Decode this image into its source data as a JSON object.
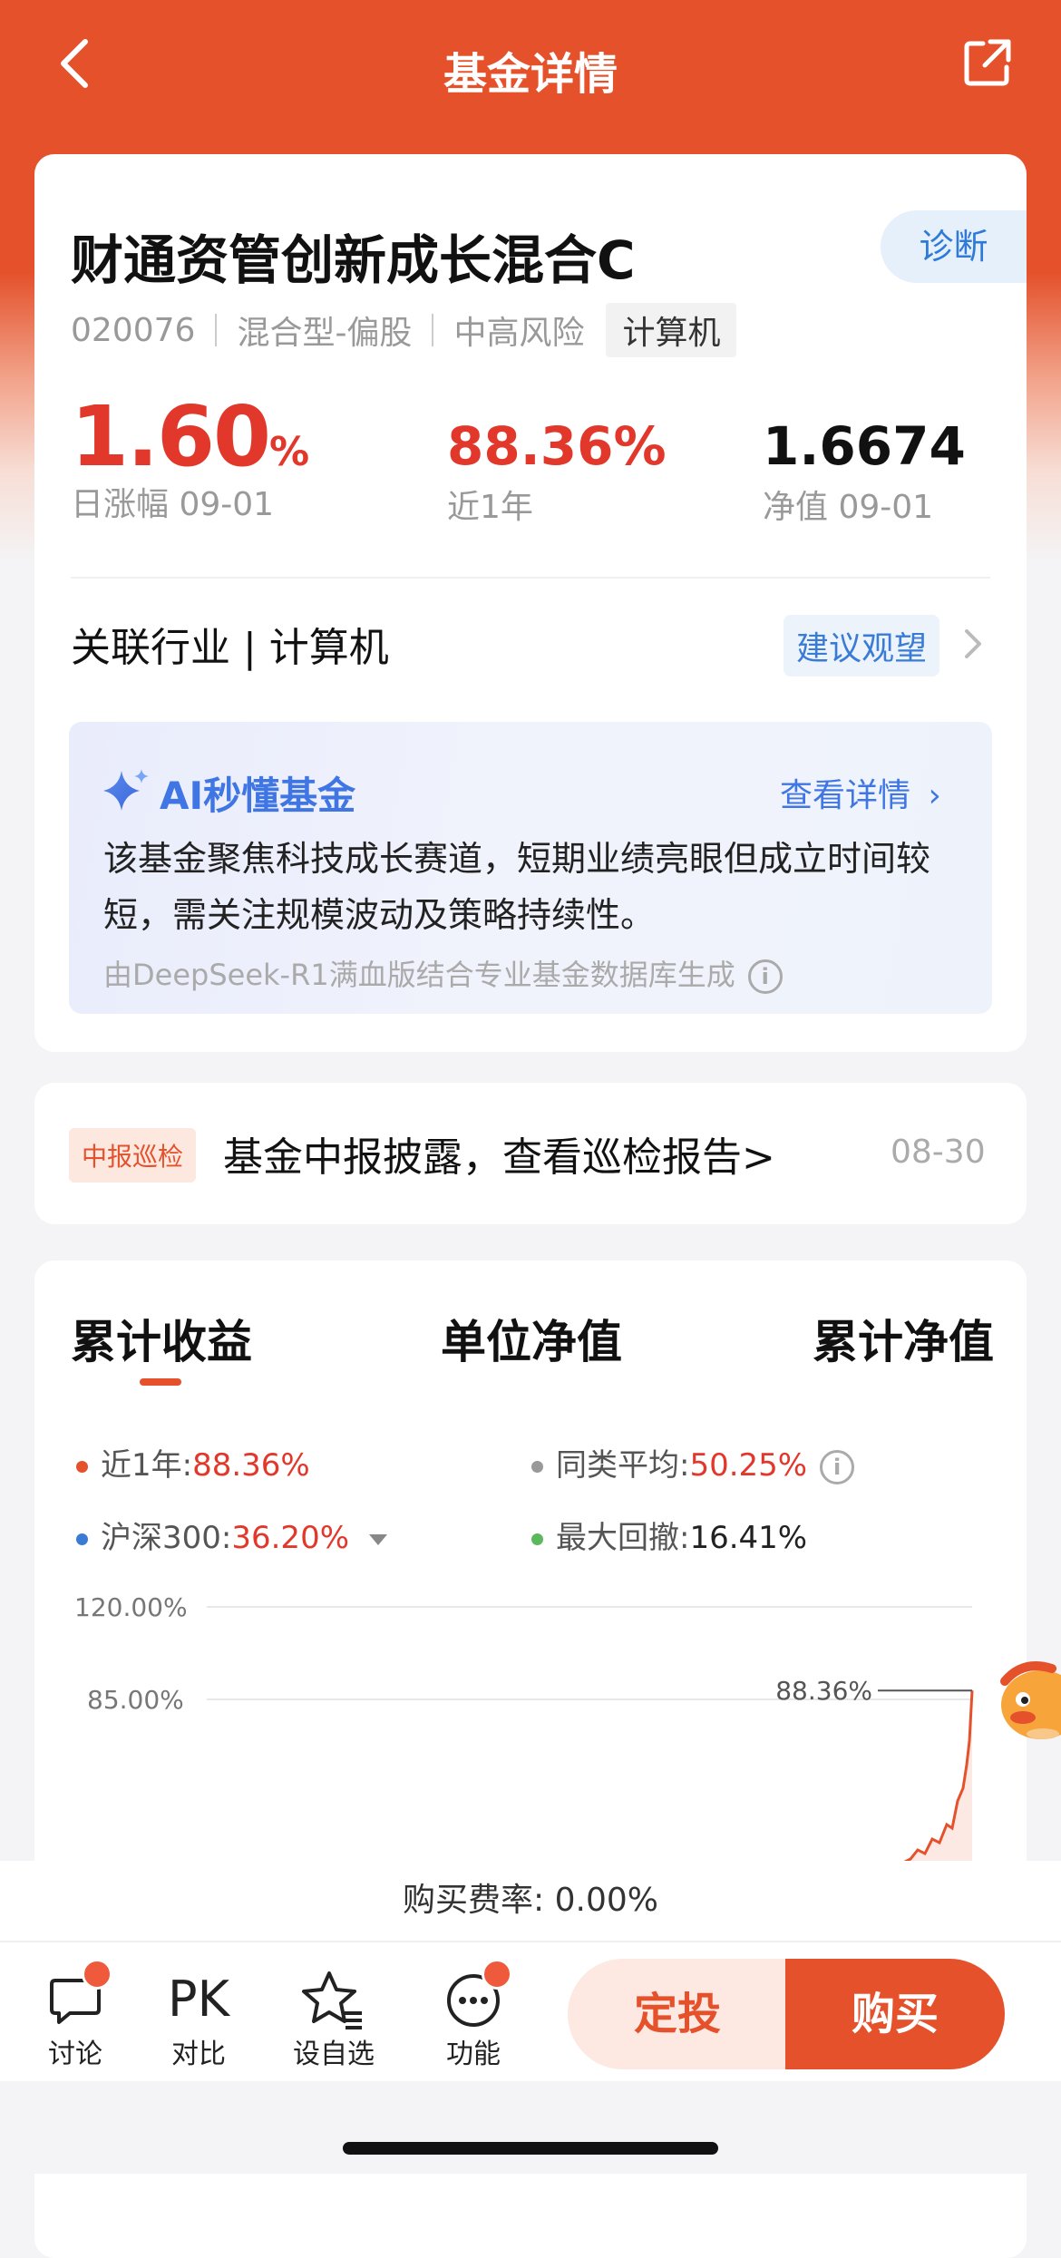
{
  "nav": {
    "title": "基金详情"
  },
  "fund": {
    "name": "财通资管创新成长混合C",
    "code": "020076",
    "type": "混合型-偏股",
    "risk": "中高风险",
    "tag": "计算机",
    "diagnose_label": "诊断"
  },
  "stats": {
    "daily_change_value": "1.60",
    "daily_change_unit": "%",
    "daily_change_label": "日涨幅 09-01",
    "year_return": "88.36%",
    "year_return_label": "近1年",
    "nav_value": "1.6674",
    "nav_label": "净值 09-01"
  },
  "industry": {
    "label": "关联行业 | 计算机",
    "suggestion": "建议观望"
  },
  "ai": {
    "title": "AI秒懂基金",
    "more": "查看详情",
    "summary": "该基金聚焦科技成长赛道，短期业绩亮眼但成立时间较短，需关注规模波动及策略持续性。",
    "source": "由DeepSeek-R1满血版结合专业基金数据库生成"
  },
  "report": {
    "tag": "中报巡检",
    "text": "基金中报披露，查看巡检报告>",
    "date": "08-30"
  },
  "tabs": [
    "累计收益",
    "单位净值",
    "累计净值"
  ],
  "legend": {
    "item1_label": "近1年:",
    "item1_value": "88.36%",
    "item2_label": "同类平均:",
    "item2_value": "50.25%",
    "item3_label": "沪深300:",
    "item3_value": "36.20%",
    "item4_label": "最大回撤:",
    "item4_value": "16.41%"
  },
  "colors": {
    "accent": "#e4512b",
    "up_red": "#e2382b",
    "legend_orange": "#e4512b",
    "legend_gray": "#999999",
    "legend_blue": "#3a7bd5",
    "legend_green": "#5cb85c"
  },
  "chart_data": {
    "type": "line",
    "ytick_labels": [
      "120.00%",
      "85.00%"
    ],
    "ytick_values": [
      120,
      85
    ],
    "series": [
      {
        "name": "近1年",
        "end_label": "88.36%",
        "end_value": 88.36
      }
    ],
    "grid": true
  },
  "fee": {
    "text": "购买费率: 0.00%"
  },
  "bottom": {
    "discuss": "讨论",
    "pk": "PK",
    "compare": "对比",
    "watchlist": "设自选",
    "functions": "功能",
    "auto_invest": "定投",
    "buy": "购买"
  }
}
